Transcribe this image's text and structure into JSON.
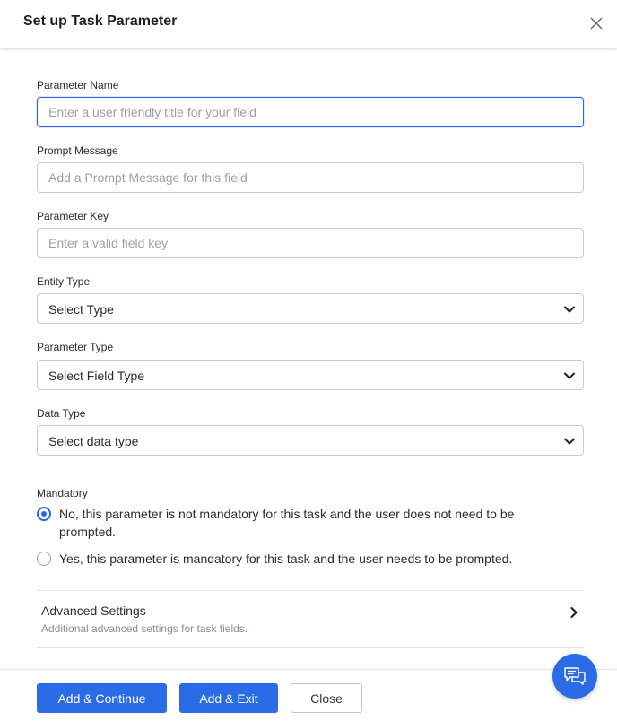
{
  "dialog": {
    "title": "Set up Task Parameter",
    "close_icon": "close-icon"
  },
  "fields": {
    "parameter_name": {
      "label": "Parameter Name",
      "placeholder": "Enter a user friendly title for your field",
      "value": ""
    },
    "prompt_message": {
      "label": "Prompt Message",
      "placeholder": "Add a Prompt Message for this field",
      "value": ""
    },
    "parameter_key": {
      "label": "Parameter Key",
      "placeholder": "Enter a valid field key",
      "value": ""
    },
    "entity_type": {
      "label": "Entity Type",
      "selected": "Select Type"
    },
    "parameter_type": {
      "label": "Parameter Type",
      "selected": "Select Field Type"
    },
    "data_type": {
      "label": "Data Type",
      "selected": "Select data type"
    }
  },
  "mandatory": {
    "label": "Mandatory",
    "options": [
      {
        "label": "No, this parameter is not mandatory for this task and the user does not need to be prompted.",
        "checked": true
      },
      {
        "label": "Yes, this parameter is mandatory for this task and the user needs to be prompted.",
        "checked": false
      }
    ]
  },
  "advanced": {
    "title": "Advanced Settings",
    "subtitle": "Additional advanced settings for task fields."
  },
  "footer": {
    "add_continue": "Add & Continue",
    "add_exit": "Add & Exit",
    "close": "Close"
  },
  "colors": {
    "accent": "#2a6be6",
    "border": "#c9ccd1"
  }
}
